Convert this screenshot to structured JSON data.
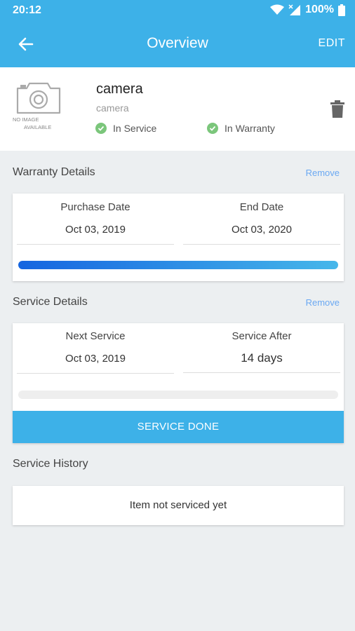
{
  "status_bar": {
    "time": "20:12",
    "battery": "100%",
    "icons": [
      "wifi-icon",
      "signal-icon",
      "battery-icon"
    ]
  },
  "app_bar": {
    "title": "Overview",
    "edit_label": "EDIT",
    "back_icon": "arrow-left-icon"
  },
  "item": {
    "image_placeholder_line1": "NO IMAGE",
    "image_placeholder_line2": "AVAILABLE",
    "name": "camera",
    "subtitle": "camera",
    "service_status": "In Service",
    "warranty_status": "In Warranty"
  },
  "warranty": {
    "title": "Warranty Details",
    "remove_label": "Remove",
    "purchase_label": "Purchase Date",
    "purchase_value": "Oct 03, 2019",
    "end_label": "End Date",
    "end_value": "Oct 03, 2020",
    "progress": 1.0
  },
  "service": {
    "title": "Service Details",
    "remove_label": "Remove",
    "next_label": "Next Service",
    "next_value": "Oct 03, 2019",
    "after_label": "Service After",
    "after_value": "14 days",
    "progress": 0.0,
    "button_label": "SERVICE DONE"
  },
  "history": {
    "title": "Service History",
    "empty_text": "Item not serviced yet"
  },
  "colors": {
    "primary": "#3db1e8",
    "status_green": "#7bc67b",
    "link": "#6aa8f2",
    "progress_start": "#1565e0",
    "progress_end": "#46b7ea"
  }
}
